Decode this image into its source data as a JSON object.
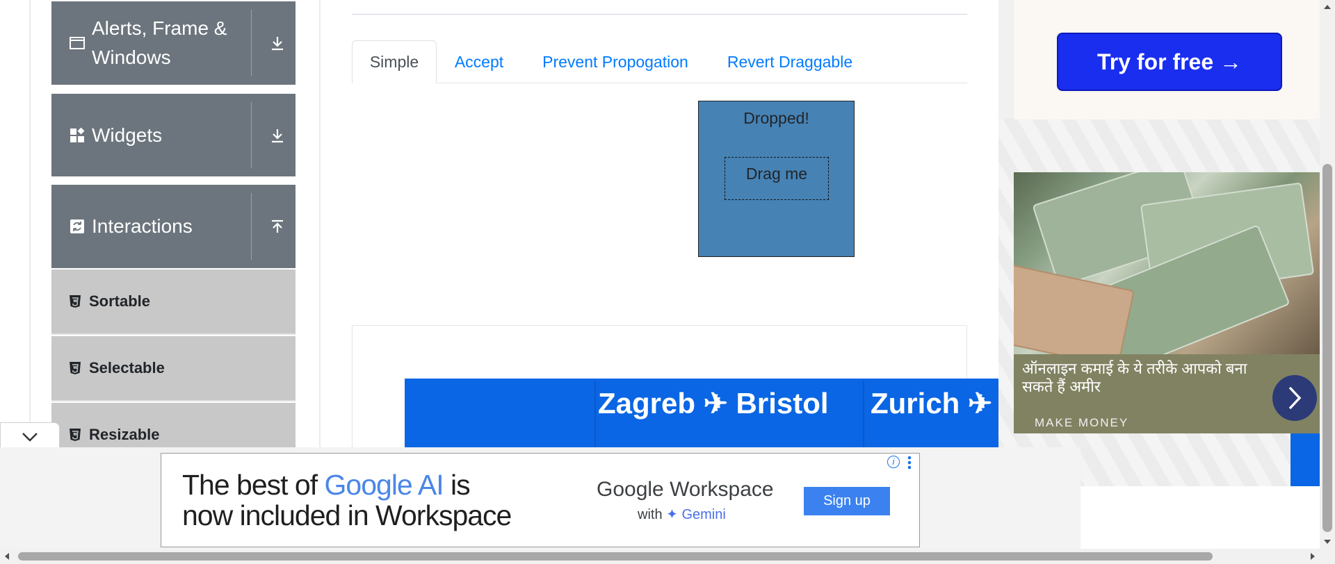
{
  "sidebar": {
    "groups": [
      {
        "label": "Alerts, Frame & Windows",
        "icon": "window-icon",
        "arrow": "download-arrow-icon"
      },
      {
        "label": "Widgets",
        "icon": "widgets-icon",
        "arrow": "download-arrow-icon"
      },
      {
        "label": "Interactions",
        "icon": "interactions-icon",
        "arrow": "upload-arrow-icon"
      }
    ],
    "items": [
      {
        "label": "Sortable",
        "icon": "html5-icon"
      },
      {
        "label": "Selectable",
        "icon": "html5-icon"
      },
      {
        "label": "Resizable",
        "icon": "html5-icon"
      }
    ],
    "collapse_icon": "chevron-down-icon"
  },
  "main": {
    "tabs": [
      {
        "label": "Simple",
        "active": true
      },
      {
        "label": "Accept",
        "active": false
      },
      {
        "label": "Prevent Propogation",
        "active": false
      },
      {
        "label": "Revert Draggable",
        "active": false
      }
    ],
    "droppable_text": "Dropped!",
    "draggable_text": "Drag me",
    "droppable_color": "#4682b4",
    "flight_ad": {
      "route1": "Zagreb ✈ Bristol",
      "route2": "Zurich ✈"
    }
  },
  "right_ads": {
    "try_button": "Try for free →",
    "money_title": "ऑनलाइन कमाई के ये तरीके आपको बना सकते हैं अमीर",
    "money_tag": "MAKE MONEY",
    "next_icon": "chevron-right-icon"
  },
  "bottom_ad": {
    "headline_part1": "The best of ",
    "headline_google": "Google AI",
    "headline_part2": " is",
    "headline_line2": "now included in Workspace",
    "brand": "Google Workspace",
    "sub_with": "with ",
    "sub_gemini": "✦ Gemini",
    "button": "Sign up",
    "info_icon": "info-icon",
    "more_icon": "more-vert-icon"
  },
  "colors": {
    "sidebar_group_bg": "#6c757d",
    "sidebar_item_bg": "#c8c8c8",
    "link_blue": "#007bff",
    "try_button_bg": "#1a2ef0",
    "flight_banner_bg": "#0a66e4"
  }
}
